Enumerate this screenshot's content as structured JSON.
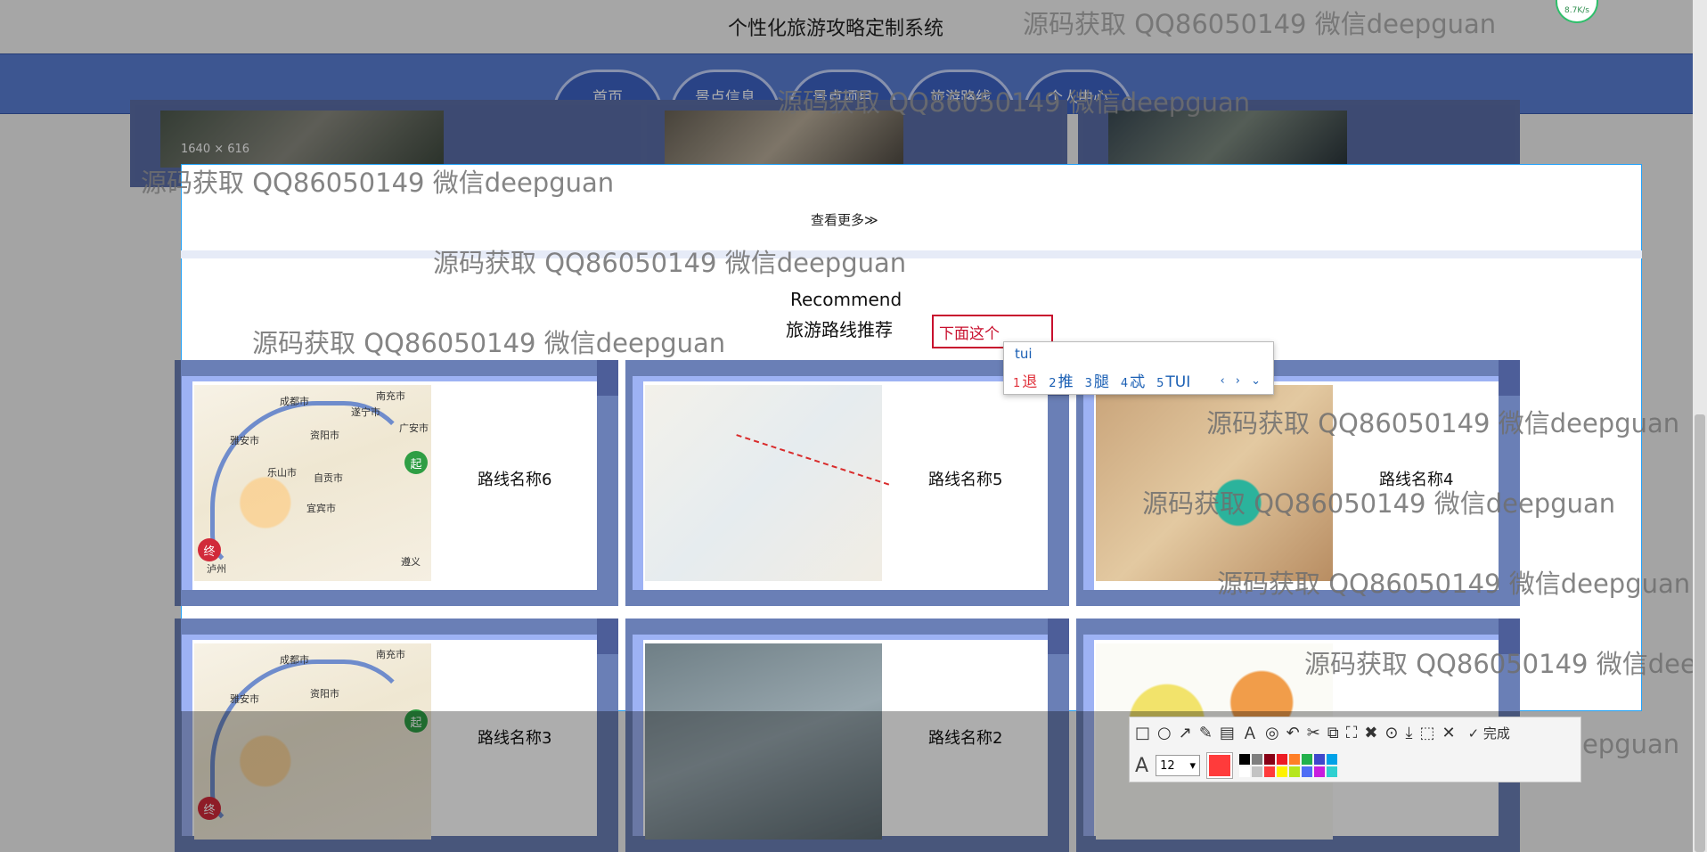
{
  "site": {
    "title": "个性化旅游攻略定制系统"
  },
  "nav": {
    "tabs": [
      "首页",
      "景点信息",
      "景点项目",
      "旅游路线",
      "个人中心"
    ]
  },
  "selection": {
    "size_label": "1640 × 616"
  },
  "more": {
    "label": "查看更多≫"
  },
  "section": {
    "en": "Recommend",
    "cn": "旅游路线推荐"
  },
  "search": {
    "value": "下面这个"
  },
  "ime": {
    "input": "tui",
    "candidates": [
      {
        "n": "1",
        "text": "退"
      },
      {
        "n": "2",
        "text": "推"
      },
      {
        "n": "3",
        "text": "腿"
      },
      {
        "n": "4",
        "text": "忒"
      },
      {
        "n": "5",
        "text": "TUI"
      }
    ],
    "nav": "‹ › ⌄"
  },
  "routes": [
    {
      "name": "路线名称6"
    },
    {
      "name": "路线名称5"
    },
    {
      "name": "路线名称4"
    },
    {
      "name": "路线名称3"
    },
    {
      "name": "路线名称2"
    }
  ],
  "map_labels": {
    "a1": "成都市",
    "a2": "南充市",
    "a3": "雅安市",
    "a4": "资阳市",
    "a5": "乐山市",
    "a6": "自贡市",
    "a7": "宜宾市",
    "a8": "广安市",
    "a9": "遂宁市",
    "a10": "泸州",
    "a11": "遵义",
    "start": "起",
    "end": "终"
  },
  "watermarks": {
    "text": "源码获取 QQ86050149 微信deepguan",
    "clipped": "源码获取 QQ86050149 微信deep"
  },
  "toolbar": {
    "tools": [
      "□",
      "○",
      "↗",
      "✎",
      "▤",
      "Ａ",
      "◎",
      "↶",
      "✂",
      "⧉",
      "⛶",
      "✖",
      "⊙",
      "⤓",
      "⬚",
      "✕"
    ],
    "done_label": "✓ 完成",
    "font_icon": "A",
    "font_size": "12",
    "size_caret": "▾",
    "current_color": "#ff3b3b",
    "palette": [
      "#000000",
      "#7f7f7f",
      "#880015",
      "#ed1c24",
      "#ff7f27",
      "#22b14c",
      "#3f48cc",
      "#00a2e8",
      "#ffffff",
      "#c3c3c3",
      "#ff3b3b",
      "#fff200",
      "#b5e61d",
      "#4f6df5",
      "#c81ede",
      "#2fd0d0"
    ]
  },
  "speed": {
    "label": "8.7K/s"
  }
}
